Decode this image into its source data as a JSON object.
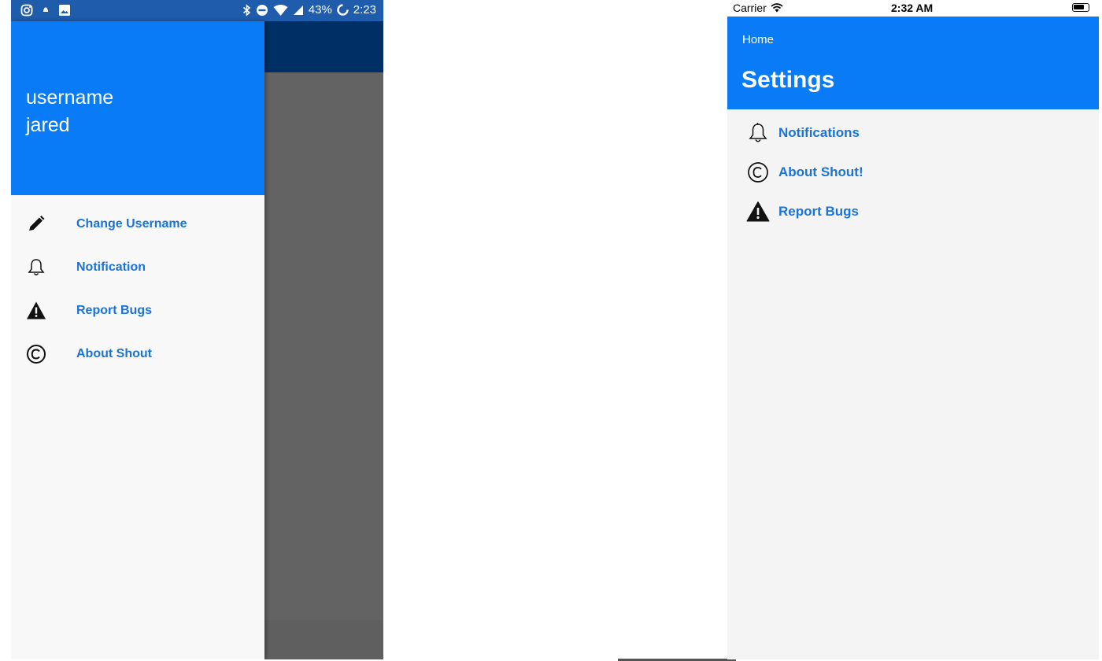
{
  "android": {
    "status_bar": {
      "battery_percent": "43%",
      "time": "2:23"
    },
    "drawer": {
      "header_line1": "username",
      "header_line2": "jared",
      "items": [
        {
          "label": "Change Username",
          "icon": "pencil-icon"
        },
        {
          "label": "Notification",
          "icon": "bell-icon"
        },
        {
          "label": "Report Bugs",
          "icon": "warning-icon"
        },
        {
          "label": "About Shout",
          "icon": "copyright-icon"
        }
      ]
    },
    "colors": {
      "status_bar": "#1f5cab",
      "header": "#0a7bf7",
      "app_bar": "#002f66",
      "link": "#1a73d6"
    }
  },
  "ios": {
    "status_bar": {
      "carrier": "Carrier",
      "time": "2:32 AM"
    },
    "navbar": {
      "back_label": "Home",
      "title": "Settings"
    },
    "items": [
      {
        "label": "Notifications",
        "icon": "bell-icon"
      },
      {
        "label": "About Shout!",
        "icon": "copyright-icon"
      },
      {
        "label": "Report Bugs",
        "icon": "warning-icon"
      }
    ],
    "colors": {
      "navbar": "#0a7bf7",
      "link": "#1a73d6",
      "background": "#f4f4f4"
    }
  }
}
